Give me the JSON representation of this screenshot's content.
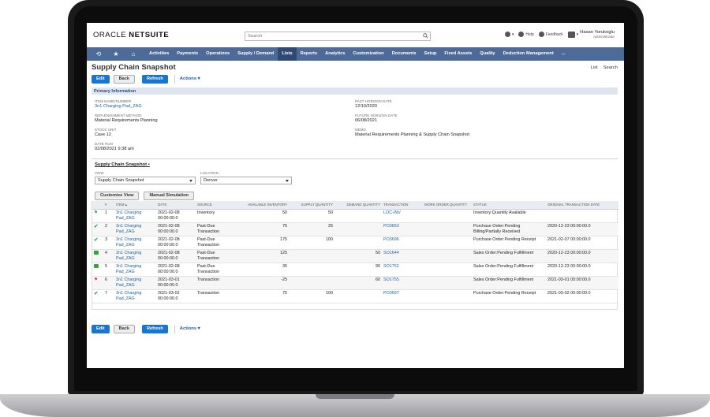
{
  "header": {
    "logo_main": "ORACLE",
    "logo_sub": "NETSUITE",
    "search_placeholder": "Search",
    "help_label": "Help",
    "feedback_label": "Feedback",
    "user_name": "Hasan Yorukoglu",
    "user_role": "Administrator"
  },
  "nav": {
    "items": [
      "Activities",
      "Payments",
      "Operations",
      "Supply / Demand",
      "Lists",
      "Reports",
      "Analytics",
      "Customization",
      "Documents",
      "Setup",
      "Fixed Assets",
      "Quality",
      "Deduction Management",
      "..."
    ],
    "active": "Lists"
  },
  "page": {
    "title": "Supply Chain Snapshot",
    "links": [
      "List",
      "Search"
    ],
    "buttons": {
      "edit": "Edit",
      "back": "Back",
      "refresh": "Refresh",
      "actions": "Actions ▾"
    }
  },
  "primary_info": {
    "section_title": "Primary Information",
    "fields": [
      {
        "label": "ITEM NAME/NUMBER",
        "value": "3n1 Charging Pad_ZAG"
      },
      {
        "label": "REPLENISHMENT METHOD",
        "value": "Material Requirements Planning"
      },
      {
        "label": "STOCK UNIT",
        "value": "Case 12"
      },
      {
        "label": "DATE RUN",
        "value": "02/08/2021 9:38 am"
      },
      {
        "label": "PAST HORIZON DATE",
        "value": "12/10/2020"
      },
      {
        "label": "FUTURE HORIZON DATE",
        "value": "06/08/2021"
      },
      {
        "label": "MEMO",
        "value": "Material Requirements Planning & Supply Chain Snapshot"
      }
    ]
  },
  "snapshot": {
    "section_title": "Supply Chain Snapshot •",
    "view_label": "VIEW",
    "view_value": "Supply Chain Snapshot",
    "location_label": "LOCATION",
    "location_value": "Denver",
    "customize_btn": "Customize View",
    "manual_btn": "Manual Simulation",
    "columns": [
      "",
      "#",
      "ITEM ▴",
      "DATE",
      "SOURCE",
      "AVAILABLE INVENTORY",
      "SUPPLY QUANTITY",
      "DEMAND QUANTITY",
      "TRANSACTION",
      "WORK ORDER QUANTITY",
      "STATUS",
      "ORIGINAL TRANSACTION DATE"
    ],
    "rows": [
      {
        "icon": "flag-green",
        "n": "1",
        "item": "3n1 Charging Pad_ZAG",
        "date": "2021-02-08 00:00:00.0",
        "source": "Inventory",
        "avail": "50",
        "supply": "50",
        "demand": "",
        "txn": "LOC-INV",
        "woq": "",
        "status": "Inventory:Quantity Available",
        "orig": ""
      },
      {
        "icon": "check",
        "n": "2",
        "item": "3n1 Charging Pad_ZAG",
        "date": "2021-02-08 00:00:00.0",
        "source": "Past-Due Transaction",
        "avail": "75",
        "supply": "25",
        "demand": "",
        "txn": "PO3653",
        "woq": "",
        "status": "Purchase Order:Pending Billing/Partially Received",
        "orig": "2020-12-23 00:00:00.0"
      },
      {
        "icon": "check",
        "n": "3",
        "item": "3n1 Charging Pad_ZAG",
        "date": "2021-02-08 00:00:00.0",
        "source": "Past-Due Transaction",
        "avail": "175",
        "supply": "100",
        "demand": "",
        "txn": "PO3696",
        "woq": "",
        "status": "Purchase Order:Pending Receipt",
        "orig": "2021-02-07 00:00:00.0"
      },
      {
        "icon": "box",
        "n": "4",
        "item": "3n1 Charging Pad_ZAG",
        "date": "2021-02-08 00:00:00.0",
        "source": "Past-Due Transaction",
        "avail": "125",
        "supply": "",
        "demand": "50",
        "txn": "SO1644",
        "woq": "",
        "status": "Sales Order:Pending Fulfillment",
        "orig": "2020-12-23 00:00:00.0"
      },
      {
        "icon": "box",
        "n": "5",
        "item": "3n1 Charging Pad_ZAG",
        "date": "2021-02-08 00:00:00.0",
        "source": "Past-Due Transaction",
        "avail": "35",
        "supply": "",
        "demand": "90",
        "txn": "SO1752",
        "woq": "",
        "status": "Sales Order:Pending Fulfillment",
        "orig": "2020-12-23 00:00:00.0"
      },
      {
        "icon": "flag-red",
        "n": "6",
        "item": "3n1 Charging Pad_ZAG",
        "date": "2021-03-01 00:00:00.0",
        "source": "Transaction",
        "avail": "-25",
        "supply": "",
        "demand": "60",
        "txn": "SO1755",
        "woq": "",
        "status": "Sales Order:Pending Fulfillment",
        "orig": "2021-03-01 00:00:00.0"
      },
      {
        "icon": "check",
        "n": "7",
        "item": "3n1 Charging Pad_ZAG",
        "date": "2021-03-02 00:00:00.0",
        "source": "Transaction",
        "avail": "75",
        "supply": "100",
        "demand": "",
        "txn": "PO3697",
        "woq": "",
        "status": "Purchase Order:Pending Receipt",
        "orig": "2021-03-02 00:00:00.0"
      }
    ]
  }
}
